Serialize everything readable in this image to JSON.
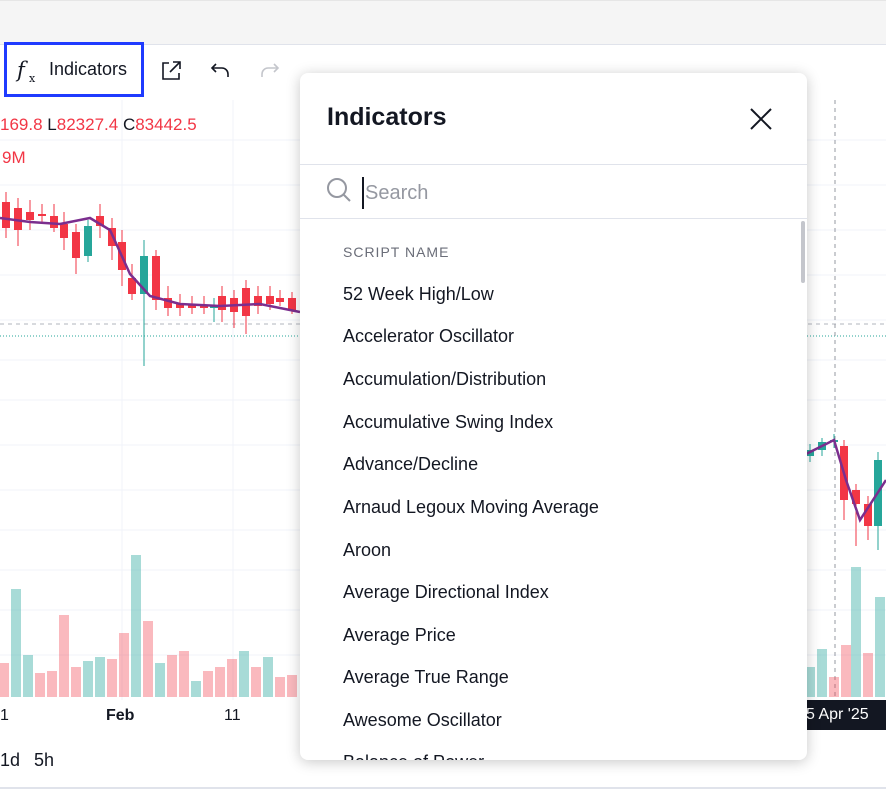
{
  "toolbar": {
    "indicators_label": "Indicators",
    "fx_symbol": "f",
    "fx_sub": "x"
  },
  "legend": {
    "ohlc_partial_value": "169.8",
    "low_key": "L",
    "low_value": "82327.4",
    "close_key": "C",
    "close_value": "83442.5",
    "volume_partial": "9M"
  },
  "time_axis": {
    "labels": [
      "1",
      "Feb",
      "11"
    ],
    "crosshair_date": "5 Apr '25"
  },
  "intervals": [
    "1d",
    "5h"
  ],
  "colors": {
    "up": "#26a69a",
    "down": "#f23645",
    "ma_line": "#7b2e8e",
    "highlight_border": "#1f3bff"
  },
  "dialog": {
    "title": "Indicators",
    "search_placeholder": "Search",
    "section_header": "SCRIPT NAME",
    "items": [
      "52 Week High/Low",
      "Accelerator Oscillator",
      "Accumulation/Distribution",
      "Accumulative Swing Index",
      "Advance/Decline",
      "Arnaud Legoux Moving Average",
      "Aroon",
      "Average Directional Index",
      "Average Price",
      "Average True Range",
      "Awesome Oscillator",
      "Balance of Power"
    ]
  }
}
